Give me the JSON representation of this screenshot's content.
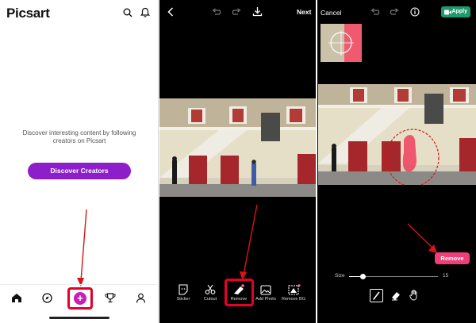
{
  "picsart_home": {
    "logo": "Picsart",
    "header_icons": [
      "search-icon",
      "bell-icon"
    ],
    "empty_message": "Discover interesting content by following creators on Picsart",
    "discover_button": "Discover Creators",
    "nav_icons": [
      "home-icon",
      "compass-icon",
      "plus-icon",
      "trophy-icon",
      "profile-icon"
    ],
    "plus_glyph": "+"
  },
  "editor": {
    "back_icon": "back-icon",
    "undo_icon": "undo-icon",
    "redo_icon": "redo-icon",
    "download_icon": "download-icon",
    "next_label": "Next",
    "tools": [
      {
        "label": "Sticker",
        "icon": "sticker-icon"
      },
      {
        "label": "Cutout",
        "icon": "scissors-icon"
      },
      {
        "label": "Remove",
        "icon": "eraser-icon"
      },
      {
        "label": "Add Photo",
        "icon": "add-photo-icon"
      },
      {
        "label": "Remove BG",
        "icon": "remove-bg-icon"
      }
    ]
  },
  "remove_tool": {
    "cancel_label": "Cancel",
    "apply_label": "Apply",
    "remove_button": "Remove",
    "size_label": "Size",
    "size_value": "15",
    "size_slider_fraction": 0.15,
    "tools": [
      "brush-icon",
      "eraser-icon",
      "hand-icon"
    ]
  },
  "colors": {
    "accent_purple": "#8c1fc9",
    "highlight_red": "#e4002b",
    "remove_pink": "#ef3f78",
    "apply_green": "#1d9a6c"
  }
}
